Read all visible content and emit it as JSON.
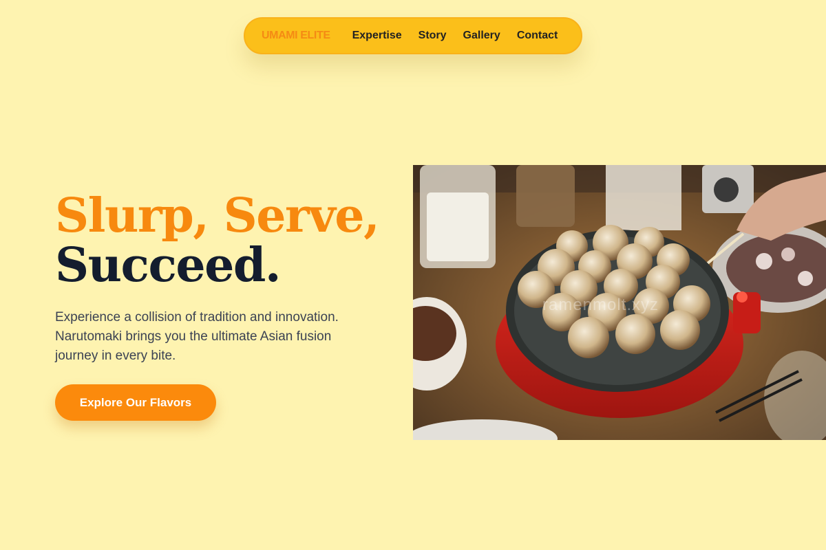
{
  "nav": {
    "brand": "UMAMI ELITE",
    "links": [
      "Expertise",
      "Story",
      "Gallery",
      "Contact"
    ]
  },
  "hero": {
    "title_line1": "Slurp, Serve,",
    "title_line2": "Succeed.",
    "description": "Experience a collision of tradition and innovation. Narutomaki brings you the ultimate Asian fusion journey in every bite.",
    "cta_label": "Explore Our Flavors"
  },
  "photo": {
    "watermark": "ramenmolt.xyz"
  },
  "colors": {
    "background": "#fef3b0",
    "nav_bg": "#fbbf1a",
    "brand": "#f58a14",
    "accent_orange": "#f7890f",
    "title_dark": "#141d2e",
    "cta_bg": "#fb8a0c"
  }
}
